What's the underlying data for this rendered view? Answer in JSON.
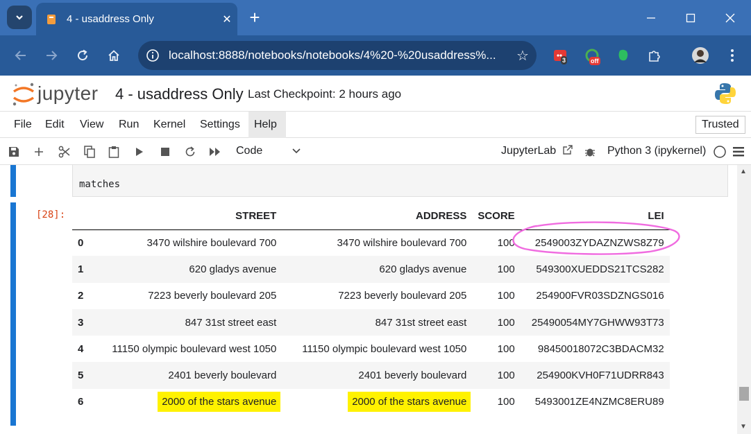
{
  "browser": {
    "tab_title": "4 - usaddress Only",
    "url": "localhost:8888/notebooks/notebooks/4%20-%20usaddress%...",
    "extension_badges": [
      "3",
      "off"
    ]
  },
  "jupyter": {
    "logo_text": "jupyter",
    "notebook_title": "4 - usaddress Only",
    "checkpoint": "Last Checkpoint: 2 hours ago",
    "menu": [
      "File",
      "Edit",
      "View",
      "Run",
      "Kernel",
      "Settings",
      "Help"
    ],
    "trusted": "Trusted",
    "cell_type": "Code",
    "jupyterlab_link": "JupyterLab",
    "kernel": "Python 3 (ipykernel)"
  },
  "cell": {
    "input_code": "matches",
    "output_prompt": "[28]:"
  },
  "table": {
    "columns": [
      "",
      "STREET",
      "ADDRESS",
      "SCORE",
      "LEI"
    ],
    "rows": [
      {
        "idx": "0",
        "street": "3470 wilshire boulevard 700",
        "address": "3470 wilshire boulevard 700",
        "score": "100",
        "lei": "2549003ZYDAZNZWS8Z79"
      },
      {
        "idx": "1",
        "street": "620 gladys avenue",
        "address": "620 gladys avenue",
        "score": "100",
        "lei": "549300XUEDDS21TCS282"
      },
      {
        "idx": "2",
        "street": "7223 beverly boulevard 205",
        "address": "7223 beverly boulevard 205",
        "score": "100",
        "lei": "254900FVR03SDZNGS016"
      },
      {
        "idx": "3",
        "street": "847 31st street east",
        "address": "847 31st street east",
        "score": "100",
        "lei": "25490054MY7GHWW93T73"
      },
      {
        "idx": "4",
        "street": "11150 olympic boulevard west 1050",
        "address": "11150 olympic boulevard west 1050",
        "score": "100",
        "lei": "98450018072C3BDACM32"
      },
      {
        "idx": "5",
        "street": "2401 beverly boulevard",
        "address": "2401 beverly boulevard",
        "score": "100",
        "lei": "254900KVH0F71UDRR843"
      },
      {
        "idx": "6",
        "street": "2000 of the stars avenue",
        "address": "2000 of the stars avenue",
        "score": "100",
        "lei": "5493001ZE4NZMC8ERU89"
      }
    ]
  },
  "colors": {
    "highlight": "#fff200",
    "annotation_circle": "#f06ce0",
    "cell_bar": "#1976d2",
    "prompt": "#d84315"
  }
}
